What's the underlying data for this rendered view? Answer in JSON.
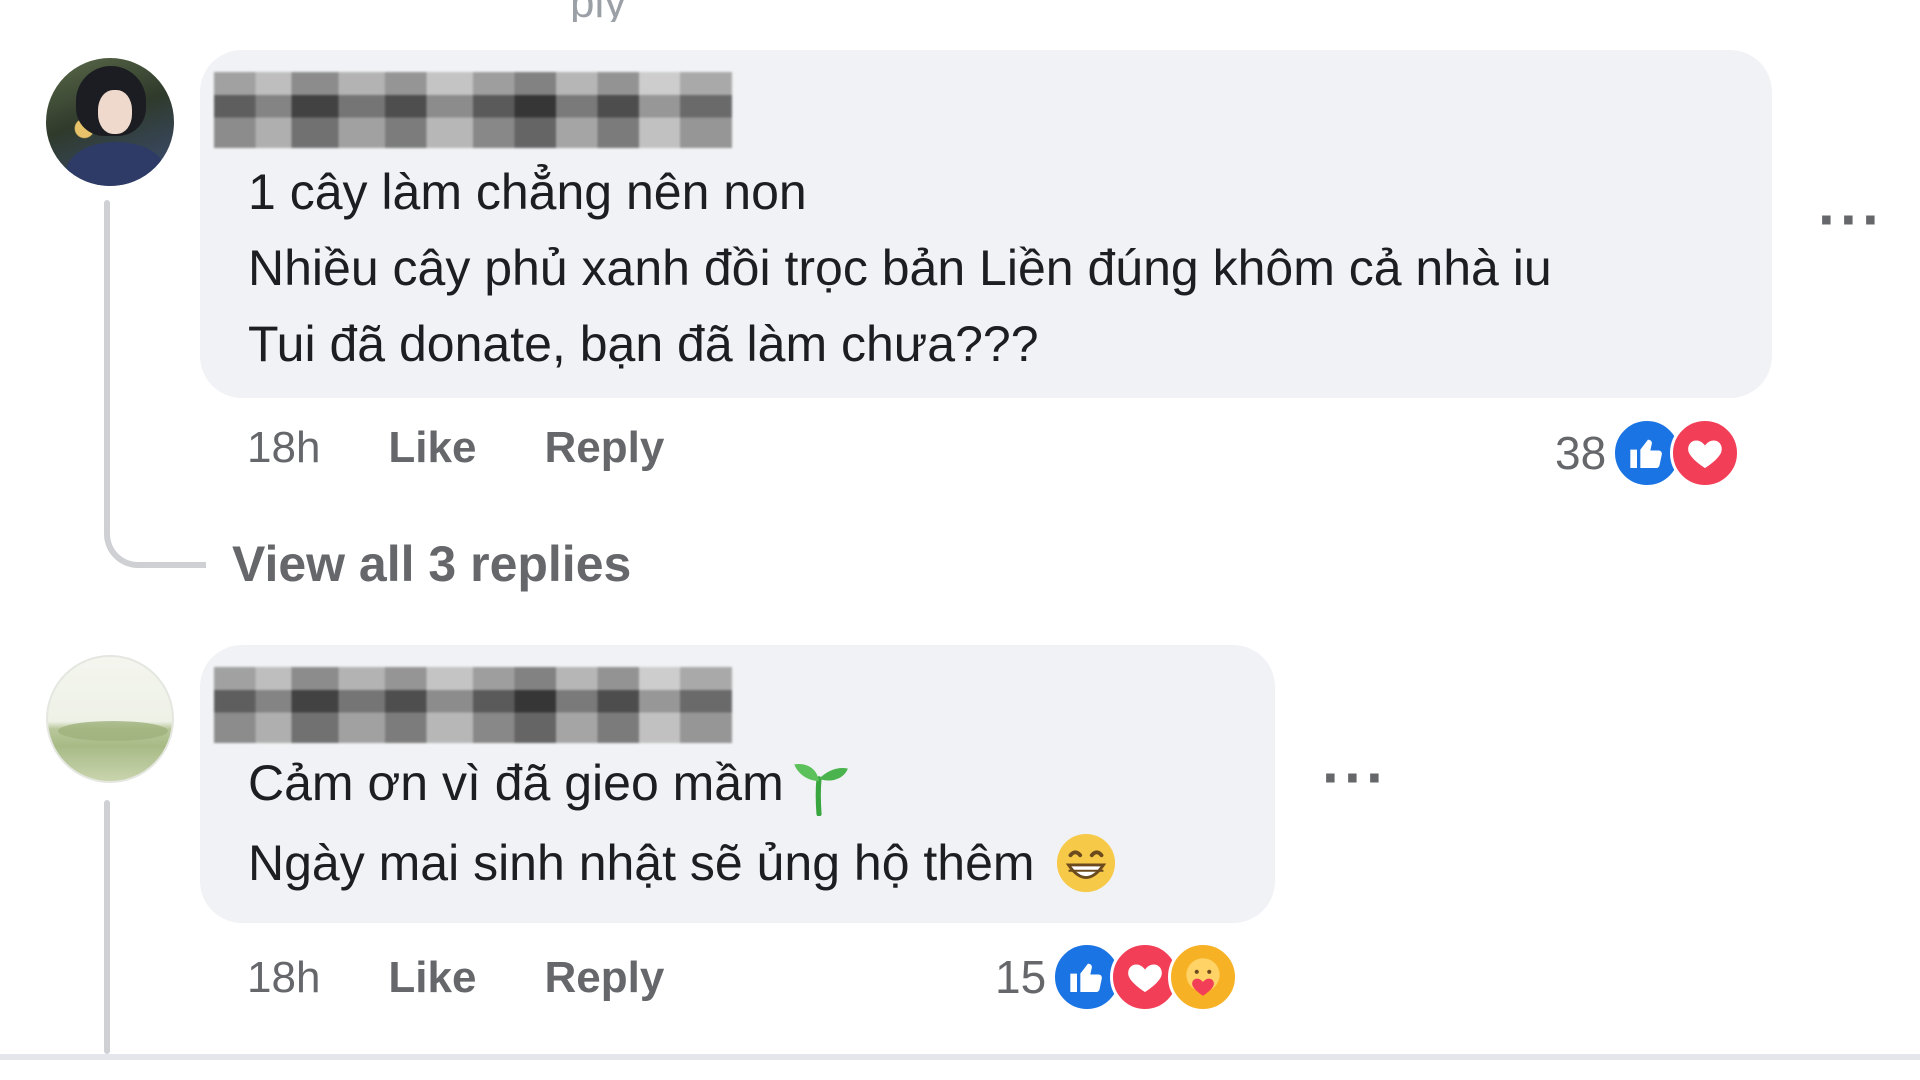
{
  "top_fragment": "ply",
  "comments": [
    {
      "text_lines": [
        "1 cây làm chẳng nên non",
        "Nhiều cây phủ xanh đồi trọc bản Liền đúng khôm cả nhà iu",
        "Tui đã donate, bạn đã làm chưa???"
      ],
      "time": "18h",
      "like_label": "Like",
      "reply_label": "Reply",
      "reaction_count": "38",
      "reactions": [
        "like-icon",
        "love-icon"
      ],
      "more_label": "···",
      "view_replies": "View all 3 replies"
    },
    {
      "text_lines": [
        "Cảm ơn vì đã gieo mầm",
        "Ngày mai sinh nhật sẽ ủng hộ thêm"
      ],
      "time": "18h",
      "like_label": "Like",
      "reply_label": "Reply",
      "reaction_count": "15",
      "reactions": [
        "like-icon",
        "love-icon",
        "care-icon"
      ],
      "more_label": "···"
    }
  ],
  "colors": {
    "bubble": "#f0f2f5",
    "meta_text": "#65676b",
    "like_blue": "#1b74e4",
    "love_red": "#f33e58",
    "care_yellow": "#f7b125"
  }
}
